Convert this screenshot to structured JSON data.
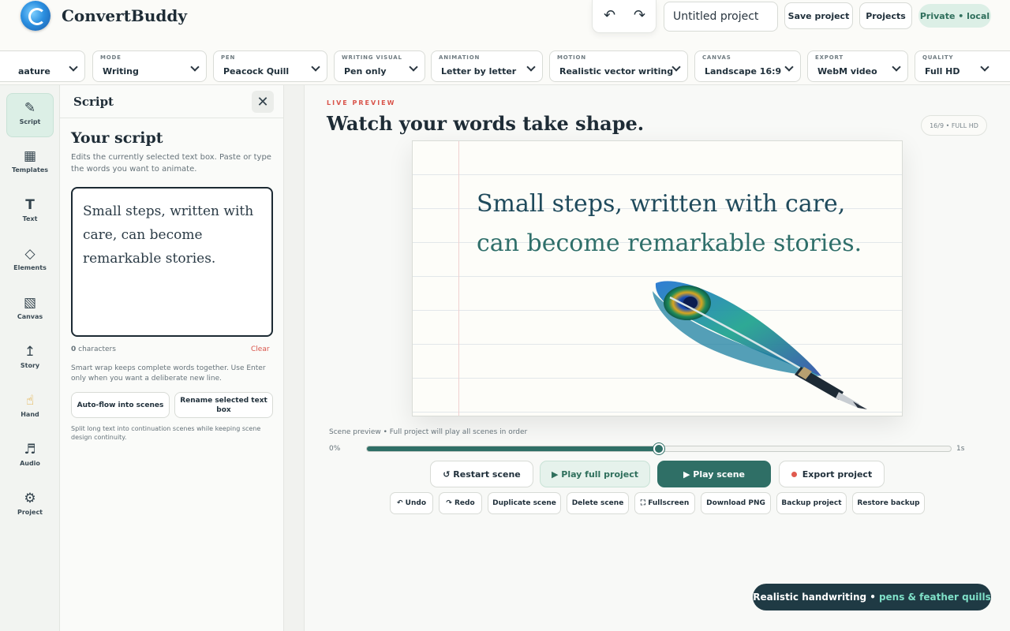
{
  "app": {
    "brand": "ConvertBuddy"
  },
  "header": {
    "undo_icon": "↶",
    "redo_icon": "↷",
    "project_name": "Untitled project",
    "save_label": "Save project",
    "projects_label": "Projects",
    "privacy_label": "Private • local"
  },
  "settings": [
    {
      "label": "",
      "value": "aature"
    },
    {
      "label": "MODE",
      "value": "Writing"
    },
    {
      "label": "PEN",
      "value": "Peacock Quill"
    },
    {
      "label": "WRITING VISUAL",
      "value": "Pen only"
    },
    {
      "label": "ANIMATION",
      "value": "Letter by letter"
    },
    {
      "label": "MOTION",
      "value": "Realistic vector writing"
    },
    {
      "label": "CANVAS",
      "value": "Landscape 16:9"
    },
    {
      "label": "EXPORT",
      "value": "WebM video"
    },
    {
      "label": "QUALITY",
      "value": "Full HD"
    }
  ],
  "rail": [
    {
      "icon": "✎",
      "label": "Script",
      "active": true
    },
    {
      "icon": "▦",
      "label": "Templates"
    },
    {
      "icon": "T",
      "label": "Text"
    },
    {
      "icon": "◇",
      "label": "Elements"
    },
    {
      "icon": "▧",
      "label": "Canvas"
    },
    {
      "icon": "↥",
      "label": "Story"
    },
    {
      "icon": "☝",
      "label": "Hand"
    },
    {
      "icon": "♬",
      "label": "Audio"
    },
    {
      "icon": "⚙",
      "label": "Project"
    }
  ],
  "panel": {
    "title": "Script",
    "close_icon": "✕",
    "heading": "Your script",
    "description": "Edits the currently selected text box. Paste or type the words you want to animate.",
    "script_text": "Small steps, written with care, can become remarkable stories.",
    "char_count": "0",
    "char_label": "characters",
    "clear_label": "Clear",
    "wrap_note": "Smart wrap keeps complete words together. Use Enter only when you want a deliberate new line.",
    "auto_flow_label": "Auto-flow into scenes",
    "rename_label": "Rename selected text box",
    "split_note": "Split long text into continuation scenes while keeping scene design continuity."
  },
  "main": {
    "live_label": "LIVE PREVIEW",
    "title": "Watch your words take shape.",
    "ratio_badge": "16/9 • FULL HD",
    "canvas_line1": "Small steps, written with care,",
    "canvas_line2": "can become remarkable stories.",
    "scene_note": "Scene preview • Full project will play all scenes in order",
    "progress_start": "0%",
    "progress_end": "1s",
    "progress_fraction": 0.5,
    "restart_label": "↺ Restart scene",
    "play_full_label": "▶ Play full project",
    "play_scene_label": "▶  Play scene",
    "export_label": "Export project",
    "small_actions": [
      "↶ Undo",
      "↷ Redo",
      "Duplicate scene",
      "Delete scene",
      "⛶ Fullscreen",
      "Download PNG",
      "Backup project",
      "Restore backup"
    ]
  },
  "toast": {
    "text": "Realistic handwriting •",
    "accent": "pens & feather quills"
  }
}
